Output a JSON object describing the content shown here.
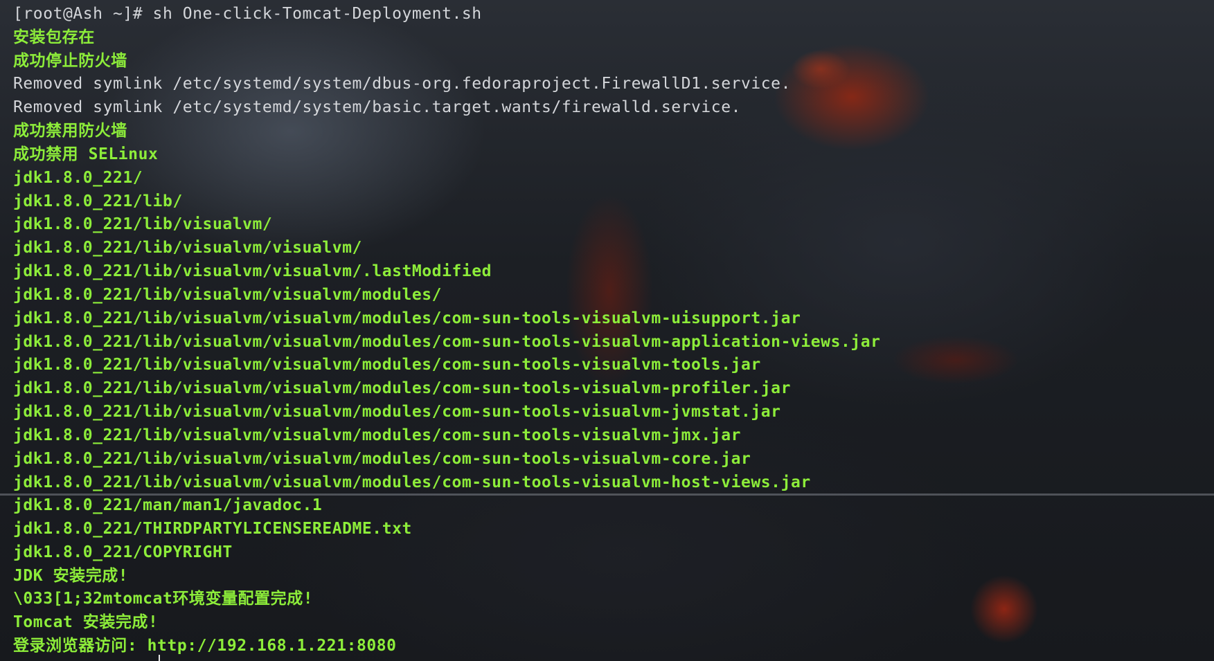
{
  "terminal": {
    "top_lines": [
      {
        "text": "[root@Ash ~]# sh One-click-Tomcat-Deployment.sh",
        "style": "plain"
      },
      {
        "text": "安装包存在",
        "style": "green"
      },
      {
        "text": "成功停止防火墙",
        "style": "green"
      },
      {
        "text": "Removed symlink /etc/systemd/system/dbus-org.fedoraproject.FirewallD1.service.",
        "style": "plain"
      },
      {
        "text": "Removed symlink /etc/systemd/system/basic.target.wants/firewalld.service.",
        "style": "plain"
      },
      {
        "text": "成功禁用防火墙",
        "style": "green"
      },
      {
        "text": "成功禁用 SELinux",
        "style": "green"
      },
      {
        "text": "jdk1.8.0_221/",
        "style": "green"
      },
      {
        "text": "jdk1.8.0_221/lib/",
        "style": "green"
      },
      {
        "text": "jdk1.8.0_221/lib/visualvm/",
        "style": "green"
      },
      {
        "text": "jdk1.8.0_221/lib/visualvm/visualvm/",
        "style": "green"
      },
      {
        "text": "jdk1.8.0_221/lib/visualvm/visualvm/.lastModified",
        "style": "green"
      },
      {
        "text": "jdk1.8.0_221/lib/visualvm/visualvm/modules/",
        "style": "green"
      },
      {
        "text": "jdk1.8.0_221/lib/visualvm/visualvm/modules/com-sun-tools-visualvm-uisupport.jar",
        "style": "green"
      },
      {
        "text": "jdk1.8.0_221/lib/visualvm/visualvm/modules/com-sun-tools-visualvm-application-views.jar",
        "style": "green"
      },
      {
        "text": "jdk1.8.0_221/lib/visualvm/visualvm/modules/com-sun-tools-visualvm-tools.jar",
        "style": "green"
      },
      {
        "text": "jdk1.8.0_221/lib/visualvm/visualvm/modules/com-sun-tools-visualvm-profiler.jar",
        "style": "green"
      },
      {
        "text": "jdk1.8.0_221/lib/visualvm/visualvm/modules/com-sun-tools-visualvm-jvmstat.jar",
        "style": "green"
      },
      {
        "text": "jdk1.8.0_221/lib/visualvm/visualvm/modules/com-sun-tools-visualvm-jmx.jar",
        "style": "green"
      },
      {
        "text": "jdk1.8.0_221/lib/visualvm/visualvm/modules/com-sun-tools-visualvm-core.jar",
        "style": "green"
      },
      {
        "text": "jdk1.8.0_221/lib/visualvm/visualvm/modules/com-sun-tools-visualvm-host-views.jar",
        "style": "green"
      }
    ],
    "bottom_lines": [
      {
        "text": "jdk1.8.0_221/man/man1/javadoc.1",
        "style": "green"
      },
      {
        "text": "jdk1.8.0_221/THIRDPARTYLICENSEREADME.txt",
        "style": "green"
      },
      {
        "text": "jdk1.8.0_221/COPYRIGHT",
        "style": "green"
      },
      {
        "text": "JDK 安装完成!",
        "style": "green"
      },
      {
        "text": "\\033[1;32mtomcat环境变量配置完成!",
        "style": "green"
      },
      {
        "text": "Tomcat 安装完成!",
        "style": "green"
      },
      {
        "text": "登录浏览器访问: http://192.168.1.221:8080",
        "style": "green"
      }
    ],
    "colors": {
      "green_text": "#8ded3a",
      "plain_text": "#d4d6da",
      "background": "#141619"
    }
  }
}
